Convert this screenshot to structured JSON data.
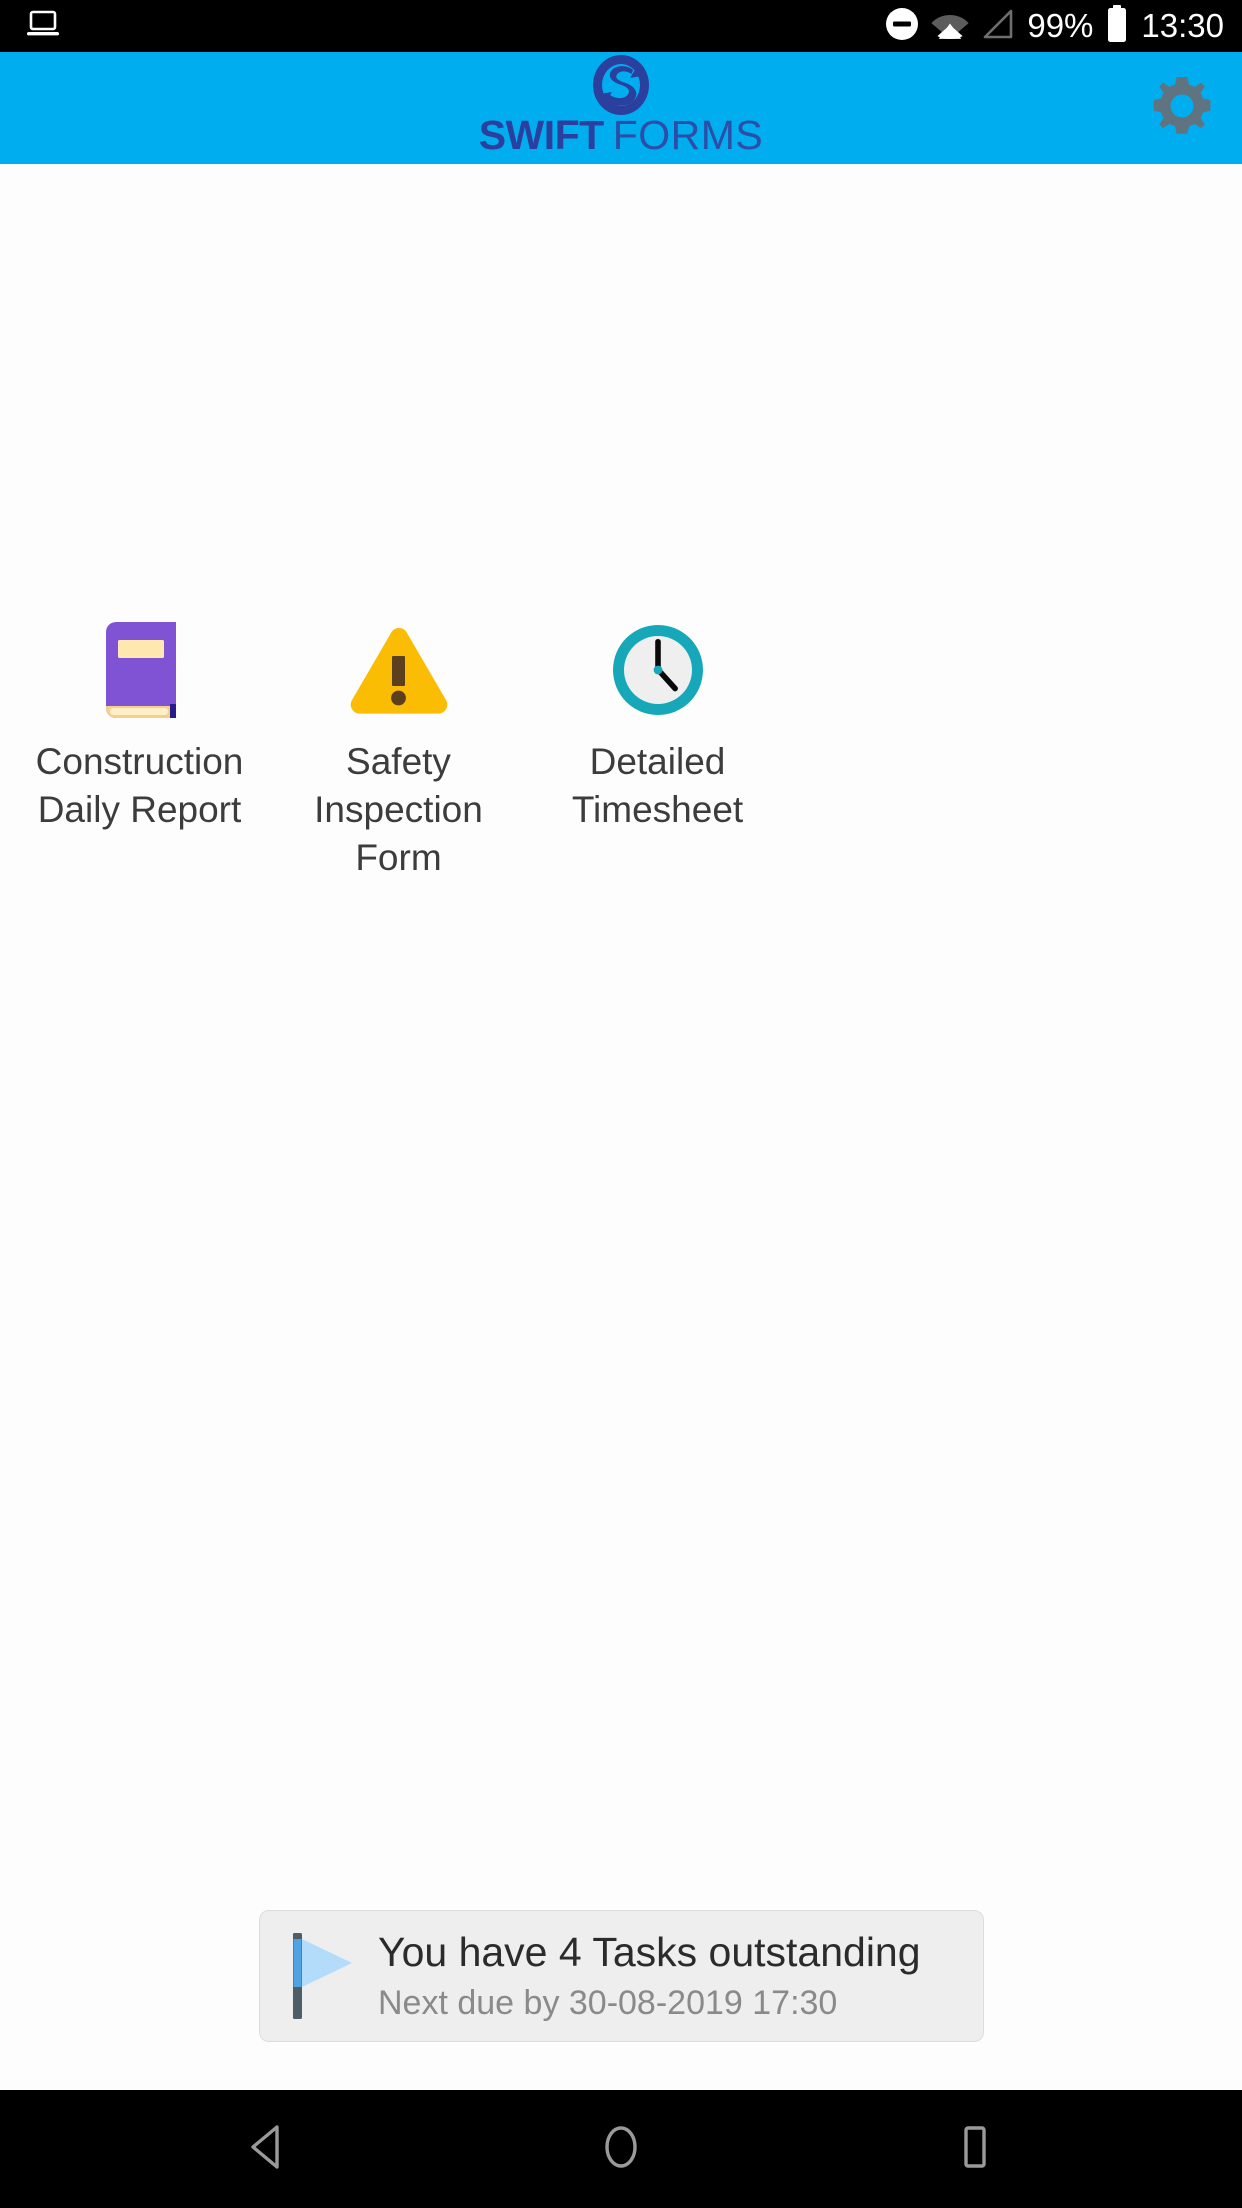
{
  "status_bar": {
    "cast_icon": "laptop-cast-icon",
    "dnd_icon": "do-not-disturb-icon",
    "wifi_icon": "wifi-icon",
    "signal_icon": "cellular-signal-icon",
    "battery_percent": "99%",
    "battery_icon": "battery-full-icon",
    "time": "13:30"
  },
  "app_bar": {
    "brand_mark_icon": "swift-s-logo-icon",
    "brand_bold": "SWIFT",
    "brand_light": "FORMS",
    "settings_icon": "gear-icon",
    "background_color": "#00aeef",
    "brand_color": "#2b3f9e"
  },
  "forms": [
    {
      "label": "Construction\nDaily Report",
      "icon": "purple-book-icon",
      "icon_color": "#8052d4"
    },
    {
      "label": "Safety\nInspection\nForm",
      "icon": "warning-triangle-icon",
      "icon_color": "#fbbc04"
    },
    {
      "label": "Detailed\nTimesheet",
      "icon": "clock-icon",
      "icon_color": "#16a8b8"
    }
  ],
  "task_banner": {
    "flag_icon": "flag-icon",
    "title": "You have 4 Tasks outstanding",
    "subtitle": "Next due by 30-08-2019 17:30",
    "task_count": "4",
    "next_due": "30-08-2019 17:30"
  },
  "nav_bar": {
    "back_icon": "back-triangle-icon",
    "home_icon": "home-circle-icon",
    "recents_icon": "recents-square-icon"
  }
}
